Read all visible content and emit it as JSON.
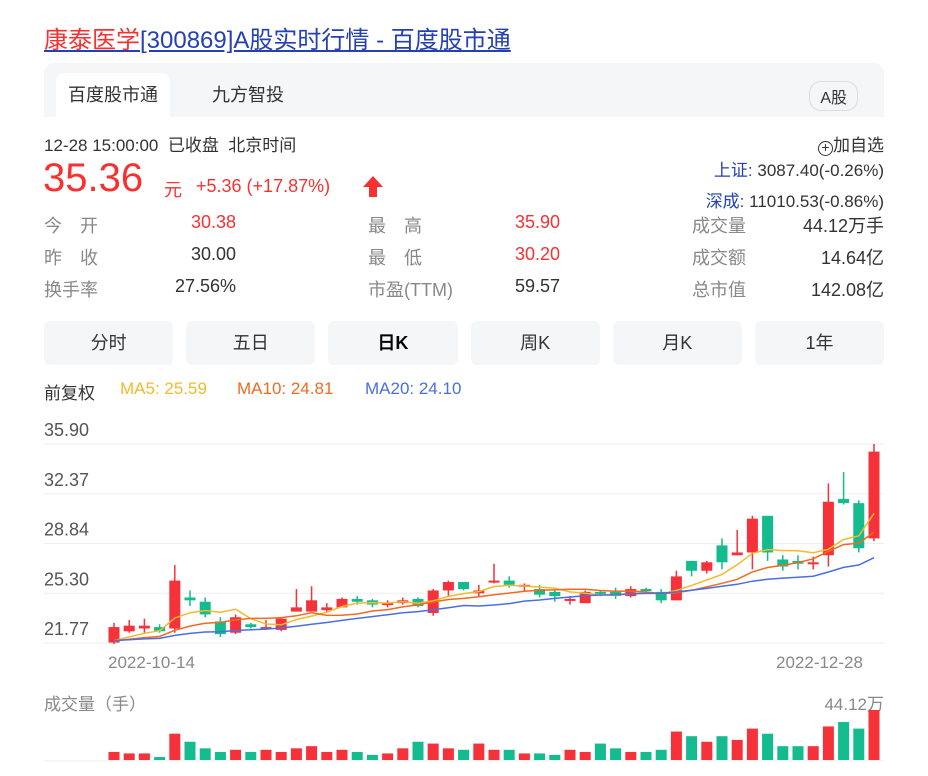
{
  "title": {
    "name": "康泰医学",
    "rest": "[300869]A股实时行情 - 百度股市通"
  },
  "tabs": [
    {
      "label": "百度股市通"
    },
    {
      "label": "九方智投"
    }
  ],
  "market_badge": "A股",
  "meta": {
    "datetime": "12-28 15:00:00",
    "status": "已收盘",
    "tz": "北京时间"
  },
  "quote": {
    "price": "35.36",
    "unit": "元",
    "change": "+5.36 (+17.87%)"
  },
  "add_watch": "加自选",
  "indices": [
    {
      "name": "上证:",
      "value": "3087.40(-0.26%)"
    },
    {
      "name": "深成:",
      "value": "11010.53(-0.86%)"
    }
  ],
  "stats": [
    [
      {
        "label": "今　开",
        "value": "30.38",
        "red": true
      },
      {
        "label": "最　高",
        "value": "35.90",
        "red": true
      },
      {
        "label": "成交量",
        "value": "44.12万手"
      }
    ],
    [
      {
        "label": "昨　收",
        "value": "30.00"
      },
      {
        "label": "最　低",
        "value": "30.20",
        "red": true
      },
      {
        "label": "成交额",
        "value": "14.64亿"
      }
    ],
    [
      {
        "label": "换手率",
        "value": "27.56%"
      },
      {
        "label": "市盈(TTM)",
        "value": "59.57"
      },
      {
        "label": "总市值",
        "value": "142.08亿"
      }
    ]
  ],
  "periods": [
    {
      "label": "分时"
    },
    {
      "label": "五日"
    },
    {
      "label": "日K"
    },
    {
      "label": "周K"
    },
    {
      "label": "月K"
    },
    {
      "label": "1年"
    }
  ],
  "ma": {
    "adj": "前复权",
    "ma5": "MA5: 25.59",
    "ma10": "MA10: 24.81",
    "ma20": "MA20: 24.10"
  },
  "colors": {
    "up": "#f5313a",
    "down": "#13bb8f",
    "ma5": "#f5b92c",
    "ma10": "#f06a1f",
    "ma20": "#4b6ee0"
  },
  "chart_data": {
    "type": "candlestick",
    "y_ticks": [
      "35.90",
      "32.37",
      "28.84",
      "25.30",
      "21.77"
    ],
    "ylim": [
      21.77,
      35.9
    ],
    "x_labels": [
      "2022-10-14",
      "2022-12-28"
    ],
    "ohlc": [
      [
        21.8,
        22.9,
        23.2,
        21.7
      ],
      [
        22.6,
        23.0,
        23.4,
        22.5
      ],
      [
        22.8,
        23.0,
        23.5,
        22.5
      ],
      [
        22.9,
        22.6,
        23.1,
        22.5
      ],
      [
        22.8,
        26.2,
        27.3,
        22.5
      ],
      [
        25.0,
        24.8,
        25.5,
        24.4
      ],
      [
        24.7,
        23.8,
        25.0,
        23.6
      ],
      [
        23.3,
        22.4,
        23.6,
        22.2
      ],
      [
        22.5,
        23.6,
        23.8,
        22.4
      ],
      [
        23.1,
        22.9,
        23.2,
        22.8
      ],
      [
        22.8,
        22.9,
        23.4,
        22.7
      ],
      [
        22.7,
        23.5,
        23.6,
        22.6
      ],
      [
        24.0,
        24.3,
        25.6,
        24.0
      ],
      [
        24.0,
        24.8,
        25.8,
        24.0
      ],
      [
        24.1,
        24.3,
        24.6,
        24.0
      ],
      [
        24.3,
        24.9,
        25.0,
        24.3
      ],
      [
        24.9,
        24.7,
        25.1,
        24.5
      ],
      [
        24.8,
        24.5,
        24.9,
        24.3
      ],
      [
        24.6,
        24.6,
        24.8,
        24.3
      ],
      [
        24.6,
        24.8,
        25.0,
        24.5
      ],
      [
        24.9,
        24.4,
        25.0,
        24.3
      ],
      [
        23.9,
        25.5,
        25.6,
        23.7
      ],
      [
        25.5,
        26.1,
        26.2,
        25.1
      ],
      [
        26.1,
        25.6,
        26.1,
        25.5
      ],
      [
        25.3,
        25.5,
        25.9,
        25.1
      ],
      [
        26.1,
        26.2,
        27.4,
        26.0
      ],
      [
        26.2,
        25.9,
        26.5,
        25.7
      ],
      [
        25.9,
        25.9,
        26.0,
        25.5
      ],
      [
        25.6,
        25.2,
        25.9,
        25.0
      ],
      [
        25.4,
        25.1,
        25.5,
        24.7
      ],
      [
        24.9,
        24.9,
        25.1,
        24.5
      ],
      [
        24.6,
        25.4,
        25.5,
        24.6
      ],
      [
        25.4,
        25.3,
        25.5,
        25.1
      ],
      [
        25.4,
        25.1,
        25.7,
        24.9
      ],
      [
        25.1,
        25.6,
        25.8,
        25.0
      ],
      [
        25.6,
        25.5,
        25.7,
        25.3
      ],
      [
        25.4,
        24.8,
        25.6,
        24.6
      ],
      [
        24.8,
        26.5,
        26.9,
        24.8
      ],
      [
        27.6,
        26.9,
        27.6,
        26.5
      ],
      [
        26.9,
        27.5,
        27.6,
        26.7
      ],
      [
        28.7,
        27.5,
        29.2,
        27.0
      ],
      [
        28.0,
        28.2,
        29.8,
        28.0
      ],
      [
        28.2,
        30.6,
        30.8,
        27.0
      ],
      [
        30.8,
        28.2,
        30.8,
        27.6
      ],
      [
        27.7,
        27.2,
        28.0,
        26.9
      ],
      [
        27.6,
        27.4,
        28.0,
        27.0
      ],
      [
        27.5,
        27.5,
        27.9,
        27.0
      ],
      [
        28.0,
        31.8,
        33.1,
        27.2
      ],
      [
        32.0,
        31.7,
        33.9,
        31.6
      ],
      [
        31.7,
        28.5,
        31.9,
        28.2
      ],
      [
        29.2,
        35.36,
        35.9,
        29.0
      ]
    ],
    "volume_label": "成交量（手）",
    "volume_max_label": "44.12万",
    "volume_wan": [
      7.1,
      5.8,
      5.8,
      2.6,
      23.2,
      16.1,
      10.3,
      7.1,
      9.0,
      7.1,
      9.0,
      7.1,
      10.3,
      12.2,
      7.1,
      9.0,
      7.1,
      4.5,
      5.8,
      10.3,
      16.1,
      14.5,
      10.3,
      9.0,
      14.5,
      9.0,
      9.0,
      5.8,
      5.8,
      4.5,
      9.0,
      7.1,
      14.5,
      10.3,
      7.1,
      7.1,
      9.0,
      25.1,
      21.0,
      16.1,
      21.0,
      17.7,
      27.7,
      23.2,
      12.2,
      12.2,
      12.2,
      29.6,
      33.5,
      27.7,
      44.12
    ]
  }
}
